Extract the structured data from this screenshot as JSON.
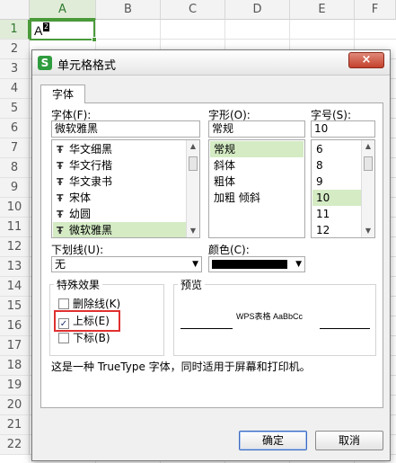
{
  "sheet": {
    "columns": [
      "A",
      "B",
      "C",
      "D",
      "E",
      "F"
    ],
    "rows": [
      "1",
      "2",
      "3",
      "4",
      "5",
      "6",
      "7",
      "8",
      "9",
      "10",
      "11",
      "12",
      "13",
      "14",
      "15",
      "16",
      "17",
      "18",
      "19",
      "20",
      "21",
      "22"
    ],
    "active_cell_text": "A",
    "active_cell_superscript": "2"
  },
  "dialog": {
    "title": "单元格格式",
    "close_symbol": "×",
    "tab_font": "字体",
    "font_label": "字体(F):",
    "font_value": "微软雅黑",
    "font_list": [
      "华文细黑",
      "华文行楷",
      "华文隶书",
      "宋体",
      "幼圆",
      "微软雅黑"
    ],
    "style_label": "字形(O):",
    "style_value": "常规",
    "style_list": [
      "常规",
      "斜体",
      "粗体",
      "加粗 倾斜"
    ],
    "size_label": "字号(S):",
    "size_value": "10",
    "size_list": [
      "6",
      "8",
      "9",
      "10",
      "11",
      "12"
    ],
    "underline_label": "下划线(U):",
    "underline_value": "无",
    "color_label": "颜色(C):",
    "effects_title": "特殊效果",
    "strikethrough_label": "删除线(K)",
    "superscript_label": "上标(E)",
    "subscript_label": "下标(B)",
    "preview_title": "预览",
    "preview_text": "WPS表格  AaBbCc",
    "description": "这是一种 TrueType 字体，同时适用于屏幕和打印机。",
    "ok_label": "确定",
    "cancel_label": "取消",
    "check_mark": "✓",
    "font_glyph": "Ŧ",
    "arrow_down": "▼",
    "arrow_up": "▲",
    "colors": {
      "accent_green": "#4a9a3a",
      "highlight_red": "#e03030",
      "selected_bg": "#d4ebc4"
    }
  }
}
